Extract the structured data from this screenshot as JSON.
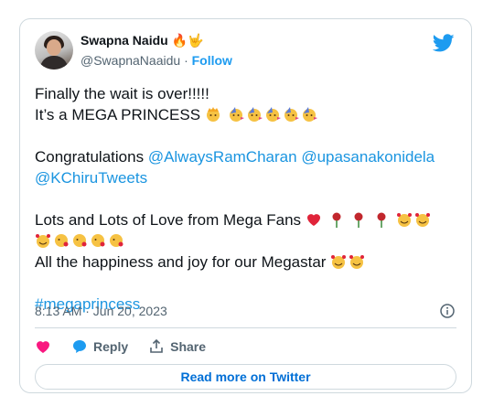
{
  "user": {
    "name": "Swapna Naidu 🔥🤟",
    "handle": "@SwapnaNaaidu",
    "separator": "·",
    "follow": "Follow"
  },
  "tweet": {
    "line1": "Finally the wait is over!!!!!",
    "line2": "It’s a MEGA PRINCESS",
    "congrats": "Congratulations",
    "mention1": "@AlwaysRamCharan",
    "mention2": "@upasanakonidela",
    "mention3": "@KChiruTweets",
    "love_line": "Lots and Lots of Love from Mega Fans",
    "happiness_line": "All the happiness and joy for our Megastar",
    "hashtag": "#megaprincess"
  },
  "meta": {
    "timestamp": "8:13 AM · Jun 20, 2023"
  },
  "actions": {
    "reply": "Reply",
    "share": "Share"
  },
  "readmore": "Read more on Twitter",
  "colors": {
    "link": "#1b95e0",
    "twitter_blue": "#1d9bf0",
    "heart": "#f91880",
    "border": "#cfd9de"
  }
}
